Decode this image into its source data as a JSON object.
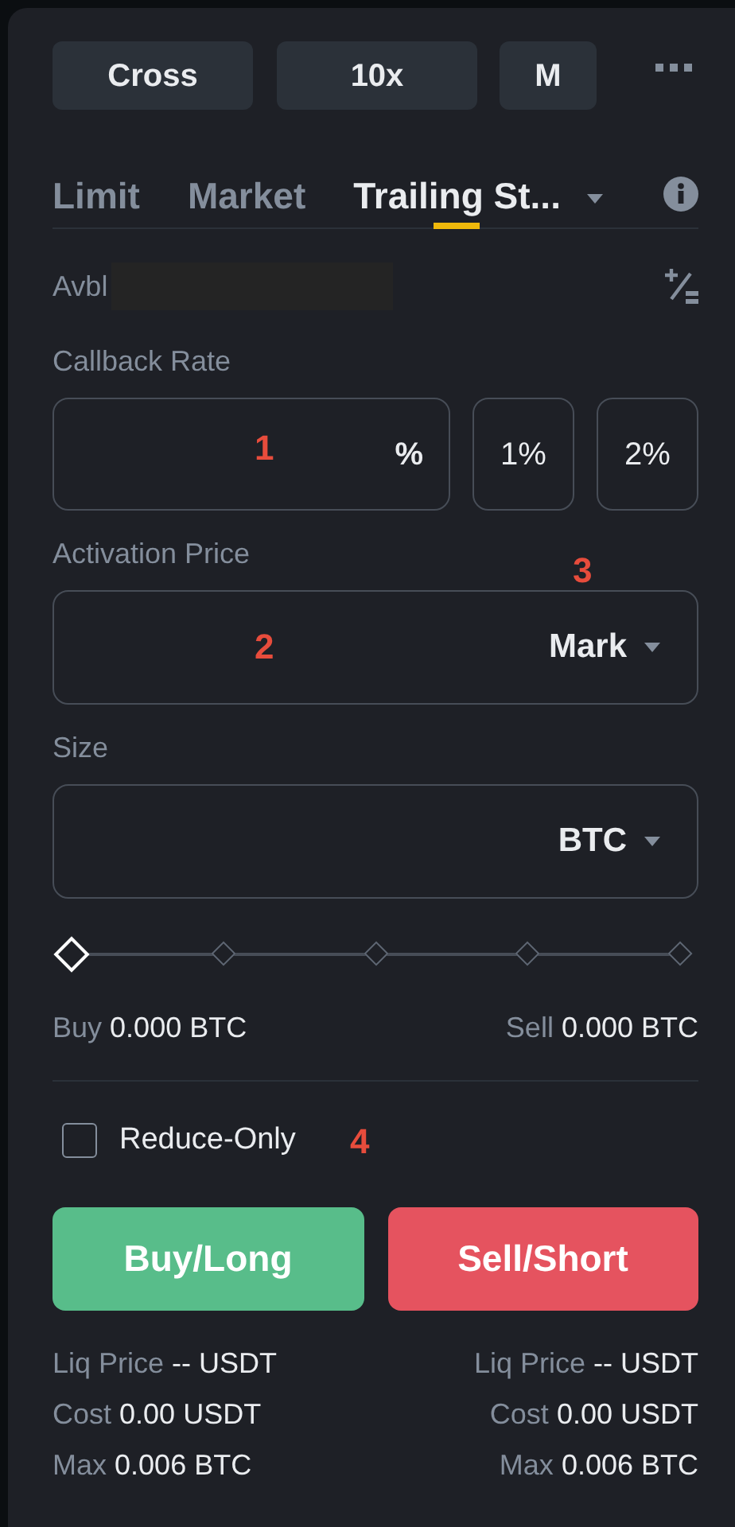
{
  "toolbar": {
    "buttons": [
      {
        "label": "Cross"
      },
      {
        "label": "10x"
      },
      {
        "label": "M"
      }
    ]
  },
  "order_tabs": [
    {
      "label": "Limit",
      "selected": false
    },
    {
      "label": "Market",
      "selected": false
    },
    {
      "label": "Trailing St...",
      "selected": true
    }
  ],
  "available": {
    "label": "Avbl",
    "redacted": true
  },
  "callback_rate": {
    "label": "Callback Rate",
    "unit": "%",
    "annotation": "1",
    "presets": [
      "1%",
      "2%"
    ]
  },
  "activation_price": {
    "label": "Activation Price",
    "price_type": "Mark",
    "annotation": "2",
    "type_annotation": "3"
  },
  "size": {
    "label": "Size",
    "unit": "BTC",
    "slider": {
      "level": 0
    }
  },
  "amounts": [
    {
      "label": "Buy",
      "value": "0.000 BTC"
    },
    {
      "label": "Sell",
      "value": "0.000 BTC"
    }
  ],
  "reduce_only": {
    "label": "Reduce-Only",
    "checked": false,
    "annotation": "4"
  },
  "actions": [
    {
      "label": "Buy/Long",
      "kind": "buy"
    },
    {
      "label": "Sell/Short",
      "kind": "sell"
    }
  ],
  "summary": [
    [
      {
        "label": "Liq Price",
        "value": "-- USDT"
      },
      {
        "label": "Cost",
        "value": "0.00 USDT"
      },
      {
        "label": "Max",
        "value": "0.006 BTC"
      }
    ],
    [
      {
        "label": "Liq Price",
        "value": "-- USDT"
      },
      {
        "label": "Cost",
        "value": "0.00 USDT"
      },
      {
        "label": "Max",
        "value": "0.006 BTC"
      }
    ]
  ]
}
